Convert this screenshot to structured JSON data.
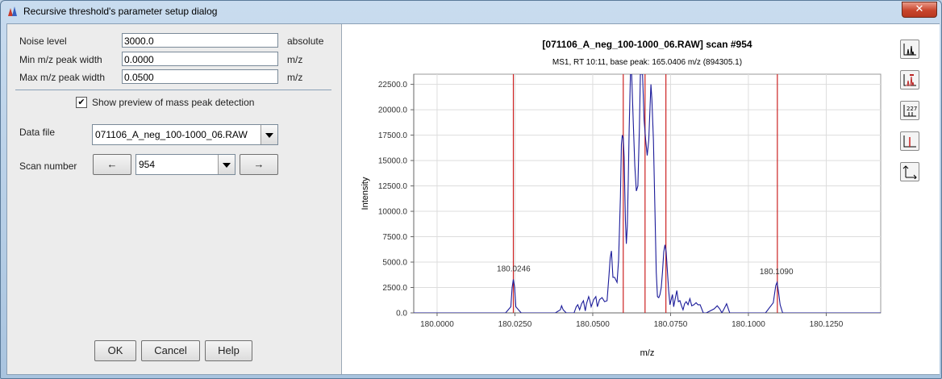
{
  "window": {
    "title": "Recursive threshold's parameter setup dialog",
    "close_glyph": "✕"
  },
  "params": {
    "noise_level": {
      "label": "Noise level",
      "value": "3000.0",
      "unit": "absolute"
    },
    "min_width": {
      "label": "Min m/z peak width",
      "value": "0.0000",
      "unit": "m/z"
    },
    "max_width": {
      "label": "Max m/z peak width",
      "value": "0.0500",
      "unit": "m/z"
    }
  },
  "preview": {
    "label": "Show preview of mass peak detection",
    "checked": true,
    "check_glyph": "✔"
  },
  "data_file": {
    "label": "Data file",
    "value": "071106_A_neg_100-1000_06.RAW"
  },
  "scan": {
    "label": "Scan number",
    "value": "954",
    "prev_glyph": "←",
    "next_glyph": "→"
  },
  "buttons": {
    "ok": "OK",
    "cancel": "Cancel",
    "help": "Help"
  },
  "toolbar": {
    "icons": [
      "continuous-mode-icon",
      "peak-labels-icon",
      "annotation-labels-icon",
      "picked-peaks-icon",
      "axes-setup-icon"
    ],
    "label_icon_text": "227"
  },
  "chart_data": {
    "type": "line",
    "title": "[071106_A_neg_100-1000_06.RAW] scan #954",
    "subtitle": "MS1, RT 10:11, base peak: 165.0406 m/z (894305.1)",
    "xlabel": "m/z",
    "ylabel": "Intensity",
    "xlim": [
      179.9925,
      180.1425
    ],
    "ylim": [
      0,
      23500
    ],
    "x_ticks": [
      "180.0000",
      "180.0250",
      "180.0500",
      "180.0750",
      "180.1000",
      "180.1250"
    ],
    "y_ticks": [
      "0.0",
      "2500.0",
      "5000.0",
      "7500.0",
      "10000.0",
      "12500.0",
      "15000.0",
      "17500.0",
      "20000.0",
      "22500.0"
    ],
    "grid": true,
    "colors": {
      "spectrum": "#1a1a99",
      "peaks": "#cc2222",
      "grid": "#dddddd"
    },
    "series": [
      {
        "x": [
          179.9925,
          180.022,
          180.0237,
          180.0241,
          180.0245,
          180.0249,
          180.0253,
          180.027,
          180.038,
          180.0396,
          180.04,
          180.0405,
          180.0415,
          180.044,
          180.0447,
          180.0452,
          180.0458,
          180.0464,
          180.047,
          180.0476,
          180.048,
          180.0487,
          180.049,
          180.0495,
          180.0503,
          180.051,
          180.0515,
          180.0522,
          180.053,
          180.0538,
          180.0546,
          180.0552,
          180.0556,
          180.056,
          180.0565,
          180.057,
          180.0578,
          180.0583,
          180.0589,
          180.0592,
          180.0595,
          180.0598,
          180.0601,
          180.0603,
          180.0605,
          180.0608,
          180.0611,
          180.0614,
          180.0617,
          180.0621,
          180.0625,
          180.063,
          180.0635,
          180.064,
          180.0645,
          180.065,
          180.0653,
          180.066,
          180.0665,
          180.067,
          180.0675,
          180.068,
          180.0687,
          180.069,
          180.0695,
          180.07,
          180.0704,
          180.0708,
          180.0712,
          180.0716,
          180.072,
          180.0724,
          180.0728,
          180.0732,
          180.0736,
          180.074,
          180.0744,
          180.0748,
          180.0752,
          180.0756,
          180.076,
          180.0765,
          180.077,
          180.0775,
          180.078,
          180.0785,
          180.079,
          180.0795,
          180.08,
          180.0806,
          180.0812,
          180.0818,
          180.0825,
          180.0832,
          180.0838,
          180.0845,
          180.0855,
          180.0865,
          180.089,
          180.09,
          180.0908,
          180.0915,
          180.0922,
          180.093,
          180.094,
          180.1055,
          180.108,
          180.1088,
          180.1092,
          180.1097,
          180.1102,
          180.111,
          180.112,
          180.1425
        ],
        "y": [
          0,
          0,
          600,
          2500,
          3300,
          2500,
          600,
          0,
          0,
          300,
          700,
          300,
          0,
          0,
          600,
          800,
          300,
          900,
          1200,
          200,
          900,
          1600,
          1300,
          600,
          1300,
          1600,
          600,
          1300,
          1500,
          1100,
          1200,
          3600,
          5400,
          6100,
          3500,
          3500,
          3000,
          5200,
          11500,
          16600,
          17500,
          17200,
          15300,
          12000,
          9000,
          6800,
          8500,
          13000,
          18000,
          23500,
          23500,
          19000,
          14500,
          12000,
          12500,
          18200,
          23500,
          23500,
          19000,
          17000,
          15500,
          17000,
          22500,
          21000,
          17000,
          10000,
          4000,
          1600,
          1500,
          1800,
          2500,
          4000,
          6000,
          6700,
          6000,
          4000,
          2200,
          800,
          1300,
          1800,
          600,
          1400,
          2200,
          1100,
          1200,
          700,
          300,
          900,
          1100,
          800,
          1400,
          700,
          800,
          1000,
          800,
          800,
          0,
          0,
          400,
          700,
          400,
          0,
          400,
          900,
          0,
          0,
          1000,
          2700,
          3000,
          2000,
          800,
          0,
          0,
          0
        ]
      }
    ],
    "detected_peaks": [
      180.0245,
      180.0598,
      180.0668,
      180.0735,
      180.1093
    ],
    "annotations": [
      {
        "text": "180.0246",
        "x": 180.0246,
        "y": 3300
      },
      {
        "text": "180.1090",
        "x": 180.109,
        "y": 3000
      }
    ]
  }
}
